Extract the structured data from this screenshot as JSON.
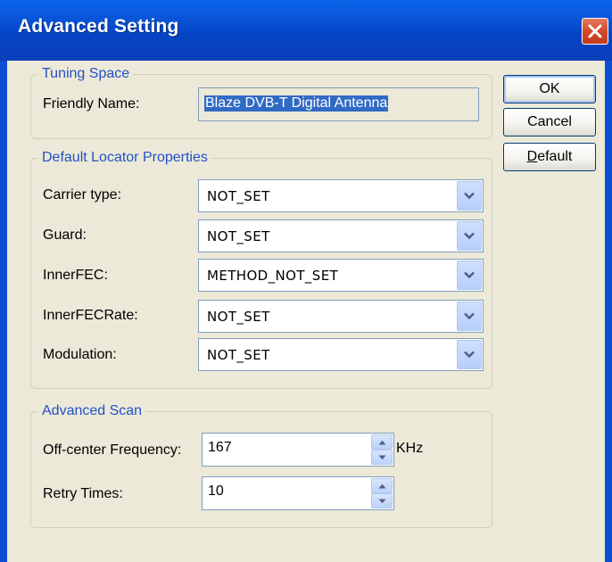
{
  "window": {
    "title": "Advanced Setting"
  },
  "tuning_space": {
    "legend": "Tuning Space",
    "friendly_name_label": "Friendly Name:",
    "friendly_name_value": "Blaze DVB-T Digital Antenna"
  },
  "locator": {
    "legend": "Default Locator Properties",
    "fields": [
      {
        "label": "Carrier type:",
        "value": "NOT_SET"
      },
      {
        "label": "Guard:",
        "value": "NOT_SET"
      },
      {
        "label": "InnerFEC:",
        "value": "METHOD_NOT_SET"
      },
      {
        "label": "InnerFECRate:",
        "value": "NOT_SET"
      },
      {
        "label": "Modulation:",
        "value": "NOT_SET"
      }
    ]
  },
  "advanced_scan": {
    "legend": "Advanced Scan",
    "offset_label": "Off-center Frequency:",
    "offset_value": "167",
    "offset_unit": "KHz",
    "retry_label": "Retry Times:",
    "retry_value": "10"
  },
  "buttons": {
    "ok": "OK",
    "cancel": "Cancel",
    "default_prefix": "D",
    "default_rest": "efault"
  },
  "icons": {
    "close": "close-icon",
    "dropdown": "chevron-down-icon",
    "spin_up": "spin-up-icon",
    "spin_down": "spin-down-icon"
  },
  "colors": {
    "title_bar": "#0545c7",
    "dialog_face": "#ece9d8",
    "group_legend": "#2250c8",
    "selection": "#316ac5",
    "close_button": "#d34a2c"
  }
}
